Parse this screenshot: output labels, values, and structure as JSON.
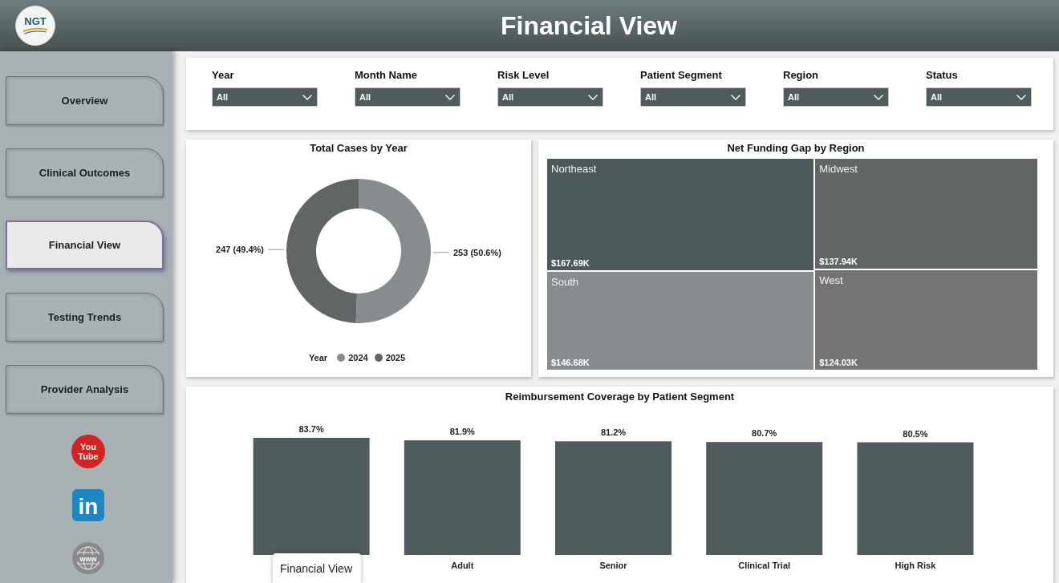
{
  "header": {
    "logo_text": "NGT",
    "title": "Financial View"
  },
  "nav": [
    {
      "label": "Overview",
      "selected": false
    },
    {
      "label": "Clinical Outcomes",
      "selected": false
    },
    {
      "label": "Financial View",
      "selected": true
    },
    {
      "label": "Testing Trends",
      "selected": false
    },
    {
      "label": "Provider Analysis",
      "selected": false
    }
  ],
  "social_links": [
    {
      "kind": "video",
      "lines": [
        "You",
        "Tube"
      ]
    },
    {
      "kind": "network",
      "lines": [
        "in"
      ]
    },
    {
      "kind": "web",
      "lines": [
        "www"
      ]
    }
  ],
  "filters": [
    {
      "label": "Year",
      "value": "All"
    },
    {
      "label": "Month Name",
      "value": "All"
    },
    {
      "label": "Risk Level",
      "value": "All"
    },
    {
      "label": "Patient Segment",
      "value": "All"
    },
    {
      "label": "Region",
      "value": "All"
    },
    {
      "label": "Status",
      "value": "All"
    }
  ],
  "cases_chart": {
    "legend_title": "Year",
    "chart_data": {
      "type": "donut",
      "title": "Total Cases by Year",
      "categories": [
        "2024",
        "2025"
      ],
      "values": [
        253,
        247
      ],
      "colors": [
        "#878c8e",
        "#616566"
      ],
      "data_labels": true,
      "value_labels": [
        "253 (50.6%)",
        "247 (49.4%)"
      ]
    }
  },
  "funding_treemap": {
    "title": "Net Funding Gap by Region",
    "tiles": [
      {
        "name": "Northeast",
        "value": "$167.69K",
        "color": "#4d595a"
      },
      {
        "name": "South",
        "value": "$146.68K",
        "color": "#878c8f"
      },
      {
        "name": "Midwest",
        "value": "$137.94K",
        "color": "#616565"
      },
      {
        "name": "West",
        "value": "$124.03K",
        "color": "#737473"
      }
    ]
  },
  "coverage_chart": {
    "chart_data": {
      "type": "bar",
      "title": "Reimbursement Coverage by Patient Segment",
      "categories": [
        null,
        "Adult",
        "Senior",
        "Clinical Trial",
        "High Risk"
      ],
      "values": [
        83.7,
        81.9,
        81.2,
        80.7,
        80.5
      ],
      "data_labels": true,
      "value_labels": [
        "83.7%",
        "81.9%",
        "81.2%",
        "80.7%",
        "80.5%"
      ]
    }
  },
  "tooltip": {
    "text": "Financial View"
  }
}
